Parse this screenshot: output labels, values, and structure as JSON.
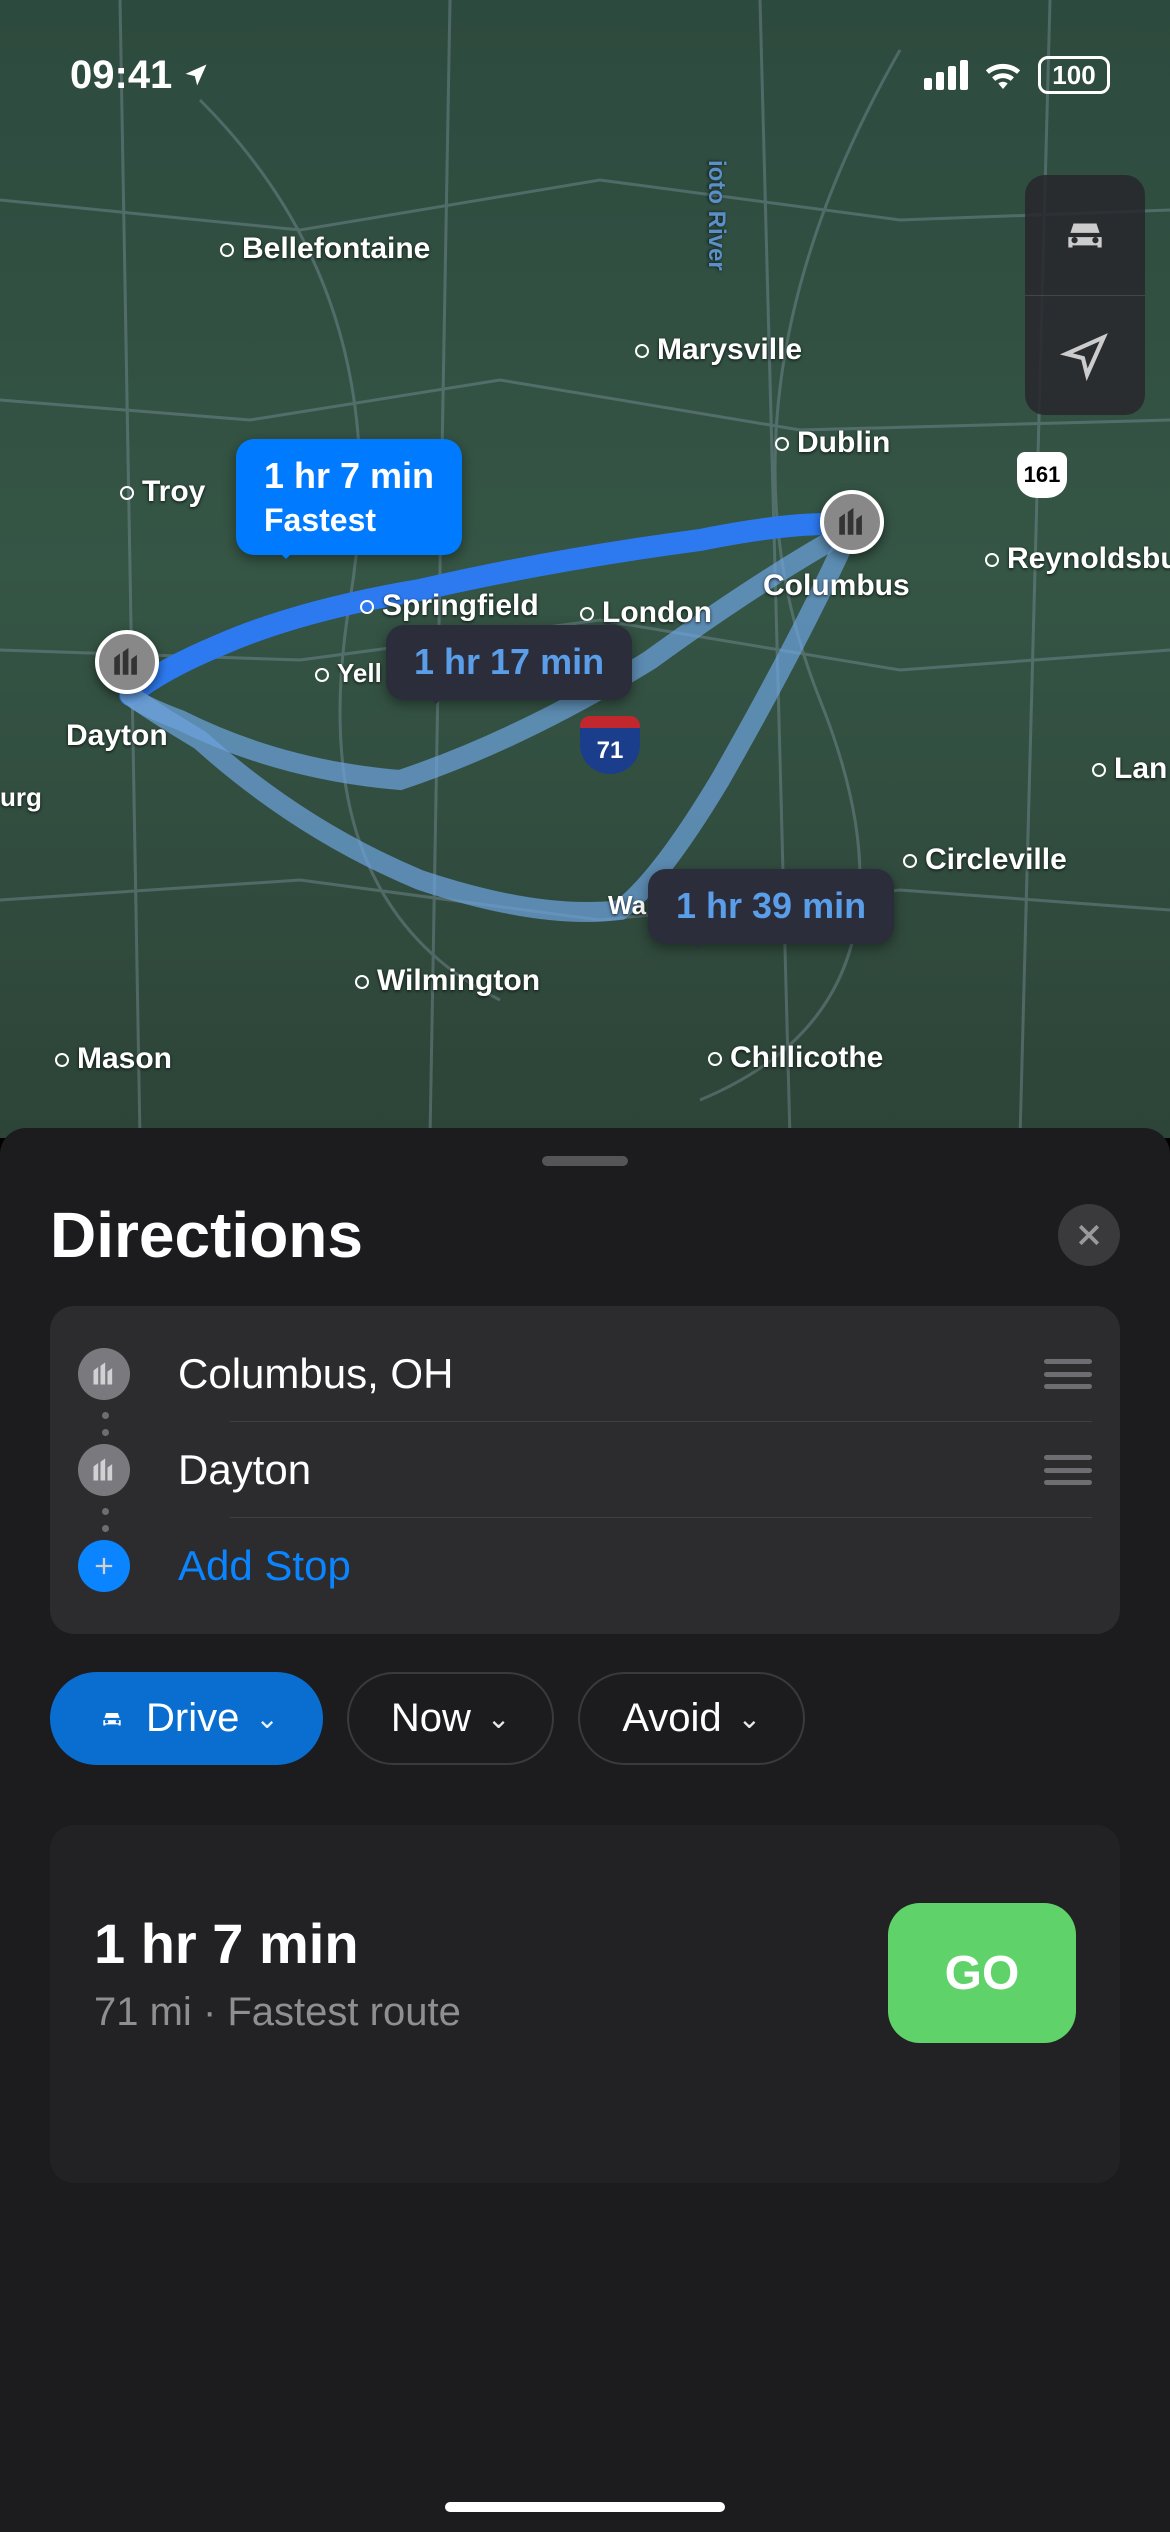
{
  "status": {
    "time": "09:41",
    "battery": "100"
  },
  "map": {
    "cities": {
      "bellefontaine": "Bellefontaine",
      "marysville": "Marysville",
      "dublin": "Dublin",
      "troy": "Troy",
      "springfield": "Springfield",
      "london": "London",
      "columbus": "Columbus",
      "reynoldsburg": "Reynoldsbur",
      "yell": "Yell",
      "dayton": "Dayton",
      "urg": "urg",
      "lan": "Lan",
      "circleville": "Circleville",
      "wa_court": "Wa Court",
      "wilmington": "Wilmington",
      "mason": "Mason",
      "chillicothe": "Chillicothe",
      "ioto_river": "ioto River"
    },
    "routes": [
      {
        "time": "1 hr 7 min",
        "sub": "Fastest",
        "selected": true
      },
      {
        "time": "1 hr 17 min",
        "selected": false
      },
      {
        "time": "1 hr 39 min",
        "selected": false
      }
    ],
    "shields": {
      "i71": "71",
      "sr161": "161"
    }
  },
  "sheet": {
    "title": "Directions",
    "stops": {
      "origin": "Columbus, OH",
      "destination": "Dayton",
      "add_label": "Add Stop"
    },
    "filters": {
      "mode": "Drive",
      "time": "Now",
      "avoid": "Avoid"
    },
    "route": {
      "time": "1 hr 7 min",
      "distance": "71 mi",
      "desc": "Fastest route",
      "go": "GO"
    }
  }
}
